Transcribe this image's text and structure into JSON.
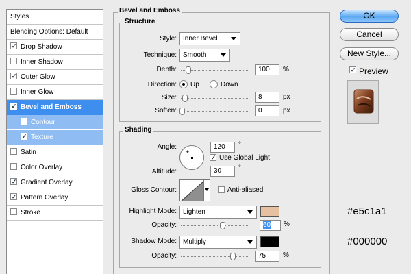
{
  "styles_panel": {
    "header": "Styles",
    "items": [
      {
        "label": "Blending Options: Default",
        "checkbox": false,
        "checked": false,
        "state": "normal"
      },
      {
        "label": "Drop Shadow",
        "checkbox": true,
        "checked": true,
        "state": "normal"
      },
      {
        "label": "Inner Shadow",
        "checkbox": true,
        "checked": false,
        "state": "normal"
      },
      {
        "label": "Outer Glow",
        "checkbox": true,
        "checked": true,
        "state": "normal"
      },
      {
        "label": "Inner Glow",
        "checkbox": true,
        "checked": false,
        "state": "normal"
      },
      {
        "label": "Bevel and Emboss",
        "checkbox": true,
        "checked": true,
        "state": "selected"
      },
      {
        "label": "Contour",
        "checkbox": true,
        "checked": false,
        "state": "sub"
      },
      {
        "label": "Texture",
        "checkbox": true,
        "checked": true,
        "state": "sub"
      },
      {
        "label": "Satin",
        "checkbox": true,
        "checked": false,
        "state": "normal"
      },
      {
        "label": "Color Overlay",
        "checkbox": true,
        "checked": false,
        "state": "normal"
      },
      {
        "label": "Gradient Overlay",
        "checkbox": true,
        "checked": true,
        "state": "normal"
      },
      {
        "label": "Pattern Overlay",
        "checkbox": true,
        "checked": true,
        "state": "normal"
      },
      {
        "label": "Stroke",
        "checkbox": true,
        "checked": false,
        "state": "normal"
      }
    ]
  },
  "main": {
    "title": "Bevel and Emboss",
    "structure": {
      "title": "Structure",
      "style_label": "Style:",
      "style_value": "Inner Bevel",
      "technique_label": "Technique:",
      "technique_value": "Smooth",
      "depth_label": "Depth:",
      "depth_value": "100",
      "depth_unit": "%",
      "direction_label": "Direction:",
      "direction_up": "Up",
      "direction_down": "Down",
      "direction_selected": "Up",
      "size_label": "Size:",
      "size_value": "8",
      "size_unit": "px",
      "soften_label": "Soften:",
      "soften_value": "0",
      "soften_unit": "px"
    },
    "shading": {
      "title": "Shading",
      "angle_label": "Angle:",
      "angle_value": "120",
      "angle_unit": "°",
      "global_light_label": "Use Global Light",
      "global_light_checked": true,
      "altitude_label": "Altitude:",
      "altitude_value": "30",
      "altitude_unit": "°",
      "gloss_contour_label": "Gloss Contour:",
      "anti_aliased_label": "Anti-aliased",
      "anti_aliased_checked": false,
      "highlight_mode_label": "Highlight Mode:",
      "highlight_mode_value": "Lighten",
      "highlight_color": "#e5c1a1",
      "highlight_opacity_label": "Opacity:",
      "highlight_opacity_value": "60",
      "highlight_opacity_unit": "%",
      "shadow_mode_label": "Shadow Mode:",
      "shadow_mode_value": "Multiply",
      "shadow_color": "#000000",
      "shadow_opacity_label": "Opacity:",
      "shadow_opacity_value": "75",
      "shadow_opacity_unit": "%"
    }
  },
  "buttons": {
    "ok": "OK",
    "cancel": "Cancel",
    "new_style": "New Style...",
    "preview_label": "Preview",
    "preview_checked": true
  },
  "annotations": {
    "highlight_hex": "#e5c1a1",
    "shadow_hex": "#000000"
  },
  "colors": {
    "selection_blue": "#3d8eee",
    "sub_item_blue": "#8fbdf3"
  }
}
